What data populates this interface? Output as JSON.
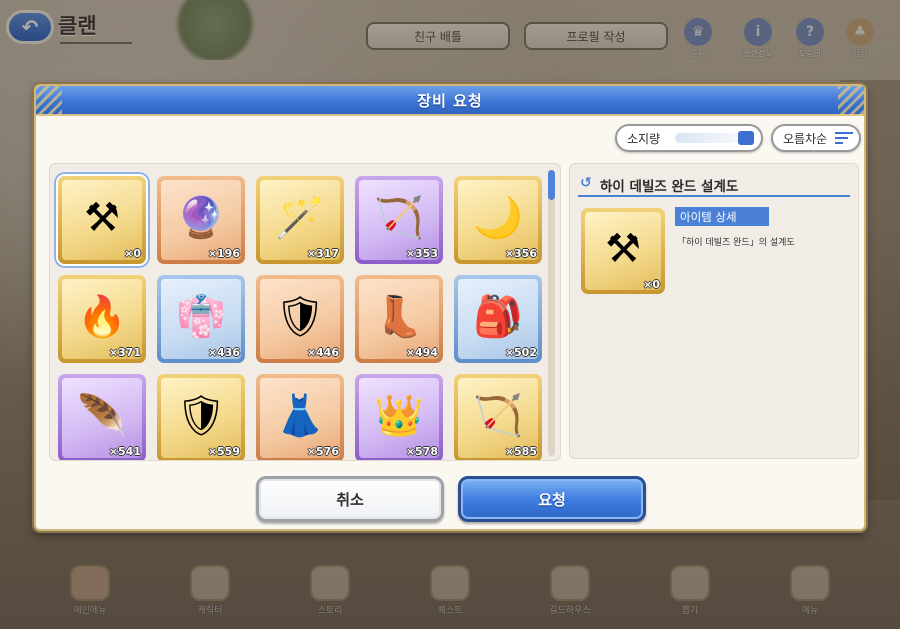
{
  "top_bar": {
    "title": "클랜",
    "back_icon": "back-arrow-icon",
    "tabs": [
      "친구 배틀",
      "프로필 작성"
    ],
    "icons": [
      {
        "icon": "crown-icon",
        "label": "순위"
      },
      {
        "icon": "info-icon",
        "label": "클랜정보"
      },
      {
        "icon": "help-icon",
        "label": "도움말"
      },
      {
        "icon": "mushroom-icon",
        "label": "상점"
      }
    ]
  },
  "modal": {
    "title": "장비 요청",
    "sort_label": "소지량",
    "order_label": "오름차순",
    "items": [
      {
        "name": "staff-blueprint",
        "glyph": "⚒",
        "qty": "×0",
        "frame": "gold",
        "selected": true
      },
      {
        "name": "blue-orb",
        "glyph": "🔮",
        "qty": "×196",
        "frame": "orange",
        "selected": false
      },
      {
        "name": "wand-blueprint",
        "glyph": "🪄",
        "qty": "×317",
        "frame": "gold",
        "selected": false
      },
      {
        "name": "bow-fragment",
        "glyph": "🏹",
        "qty": "×353",
        "frame": "purple",
        "selected": false
      },
      {
        "name": "moon-amulet",
        "glyph": "🌙",
        "qty": "×356",
        "frame": "gold",
        "selected": false
      },
      {
        "name": "flame-blueprint",
        "glyph": "🔥",
        "qty": "×371",
        "frame": "gold",
        "selected": false
      },
      {
        "name": "robe",
        "glyph": "👘",
        "qty": "×436",
        "frame": "blue",
        "selected": false
      },
      {
        "name": "armor",
        "glyph": "🛡",
        "qty": "×446",
        "frame": "orange",
        "selected": false
      },
      {
        "name": "boots",
        "glyph": "👢",
        "qty": "×494",
        "frame": "orange",
        "selected": false
      },
      {
        "name": "backpack",
        "glyph": "🎒",
        "qty": "×502",
        "frame": "blue",
        "selected": false
      },
      {
        "name": "feather-fragment",
        "glyph": "🪶",
        "qty": "×541",
        "frame": "purple",
        "selected": false
      },
      {
        "name": "shield-blueprint",
        "glyph": "🛡",
        "qty": "×559",
        "frame": "gold",
        "selected": false
      },
      {
        "name": "dress",
        "glyph": "👗",
        "qty": "×576",
        "frame": "orange",
        "selected": false
      },
      {
        "name": "dark-crown-fragment",
        "glyph": "👑",
        "qty": "×578",
        "frame": "purple",
        "selected": false
      },
      {
        "name": "bow-blueprint",
        "glyph": "🏹",
        "qty": "×585",
        "frame": "gold",
        "selected": false
      }
    ],
    "detail": {
      "title": "하이 데빌즈 완드 설계도",
      "qty": "×0",
      "glyph": "⚒",
      "tag": "아이템 상세",
      "description": "「하이 데빌즈 완드」의 설계도"
    },
    "cancel_label": "취소",
    "request_label": "요청"
  },
  "bottom_nav": [
    {
      "label": "메인메뉴",
      "active": true
    },
    {
      "label": "캐릭터",
      "active": false
    },
    {
      "label": "스토리",
      "active": false
    },
    {
      "label": "퀘스트",
      "active": false
    },
    {
      "label": "길드하우스",
      "active": false
    },
    {
      "label": "뽑기",
      "active": false
    },
    {
      "label": "메뉴",
      "active": false
    }
  ],
  "colors": {
    "header_blue": "#3d76d6",
    "accent_blue": "#4a80d6",
    "modal_bg": "#fbf8f2"
  }
}
